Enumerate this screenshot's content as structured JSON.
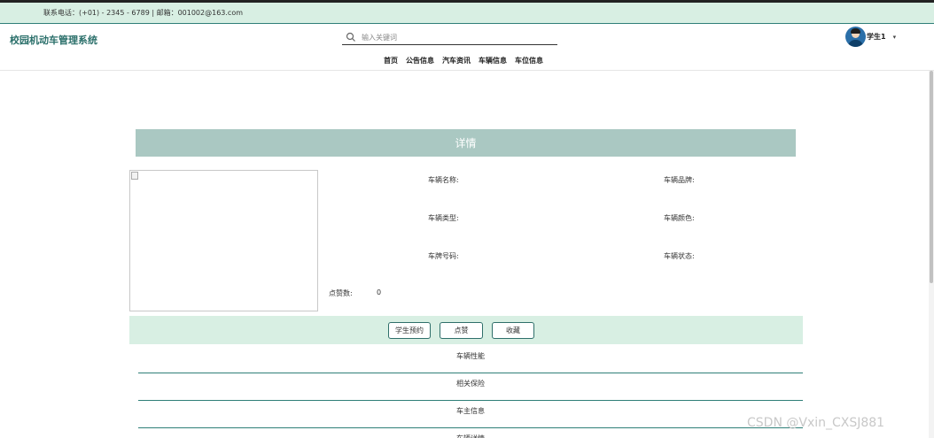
{
  "topbar": {
    "contact": "联系电话：(+01) - 2345 - 6789 | 邮箱：001002@163.com"
  },
  "header": {
    "site_title": "校园机动车管理系统",
    "search_placeholder": "输入关键词",
    "user_name": "学生1",
    "nav": [
      "首页",
      "公告信息",
      "汽车资讯",
      "车辆信息",
      "车位信息"
    ]
  },
  "detail": {
    "title": "详情",
    "fields": {
      "vehicle_name": {
        "label": "车辆名称:",
        "value": ""
      },
      "vehicle_brand": {
        "label": "车辆品牌:",
        "value": ""
      },
      "vehicle_type": {
        "label": "车辆类型:",
        "value": ""
      },
      "vehicle_color": {
        "label": "车辆颜色:",
        "value": ""
      },
      "plate_number": {
        "label": "车牌号码:",
        "value": ""
      },
      "vehicle_status": {
        "label": "车辆状态:",
        "value": ""
      },
      "likes": {
        "label": "点赞数:",
        "value": "0"
      }
    }
  },
  "actions": {
    "reserve": "学生预约",
    "like": "点赞",
    "favorite": "收藏"
  },
  "tabs": [
    "车辆性能",
    "相关保险",
    "车主信息",
    "车辆详情"
  ],
  "watermark": "CSDN @Vxin_CXSJ881",
  "colors": {
    "accent": "#2f7f78",
    "banner": "#aac8c2",
    "light_bg": "#d8efe3"
  },
  "icons": {
    "search": "search-icon",
    "dropdown": "chevron-down-icon",
    "avatar": "avatar",
    "image": "broken-image-icon"
  }
}
